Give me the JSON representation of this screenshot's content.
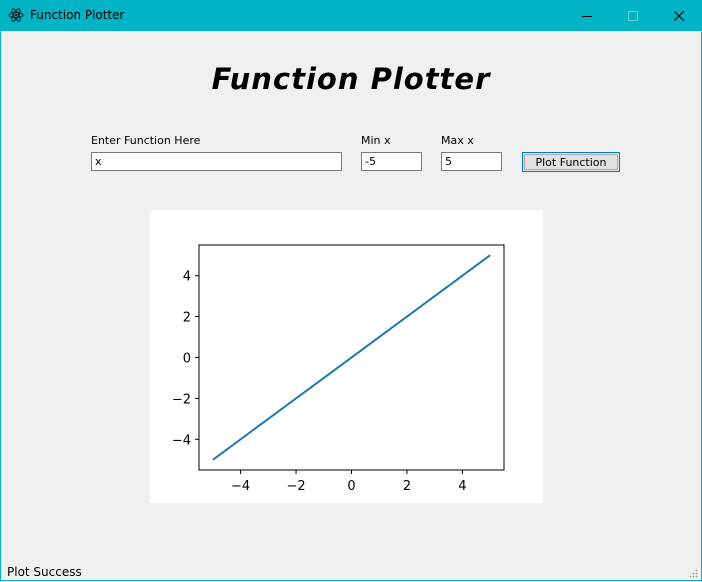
{
  "window": {
    "title": "Function Plotter",
    "icon": "app-atom-icon",
    "controls": [
      "minimize-icon",
      "maximize-icon",
      "close-icon"
    ],
    "titlebar_color": "#00b4c5"
  },
  "heading": "Function Plotter",
  "form": {
    "function_label": "Enter Function Here",
    "function_value": "x",
    "min_label": "Min x",
    "min_value": "-5",
    "max_label": "Max x",
    "max_value": "5",
    "plot_button": "Plot Function"
  },
  "chart_data": {
    "type": "line",
    "title": "",
    "xlabel": "",
    "ylabel": "",
    "xlim": [
      -5.5,
      5.5
    ],
    "ylim": [
      -5.5,
      5.5
    ],
    "xticks": [
      -4,
      -2,
      0,
      2,
      4
    ],
    "yticks": [
      -4,
      -2,
      0,
      2,
      4
    ],
    "xtick_labels": [
      "−4",
      "−2",
      "0",
      "2",
      "4"
    ],
    "ytick_labels": [
      "−4",
      "−2",
      "0",
      "2",
      "4"
    ],
    "grid": false,
    "series": [
      {
        "x": [
          -5,
          5
        ],
        "y": [
          -5,
          5
        ],
        "color": "#1f77b4"
      }
    ]
  },
  "status": "Plot Success"
}
